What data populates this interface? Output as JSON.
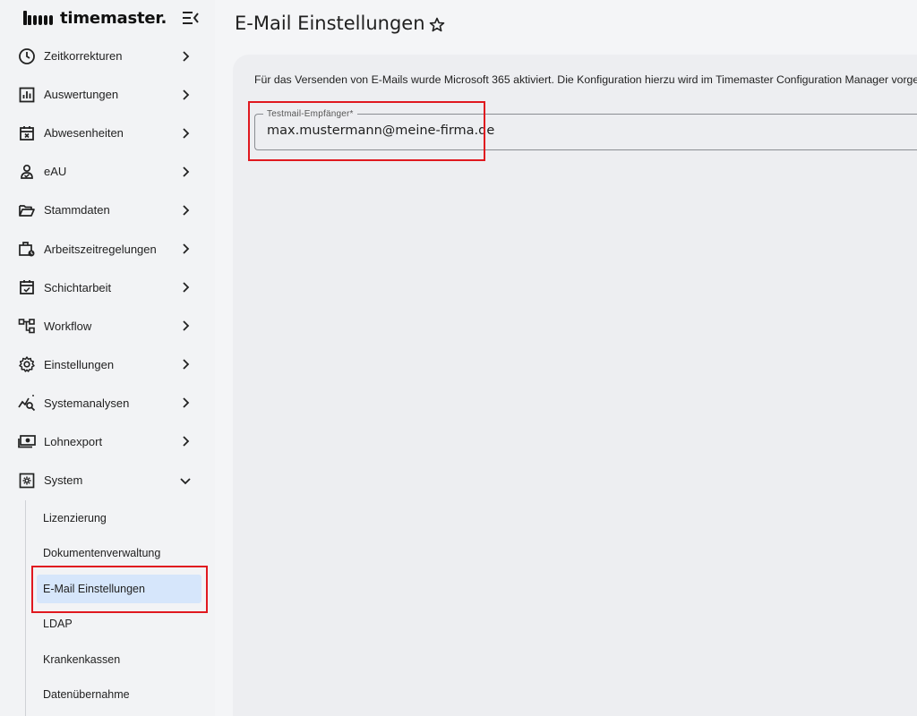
{
  "app": {
    "logo_text": "timemaster."
  },
  "sidebar": {
    "items": [
      {
        "label": "Zeitkorrekturen",
        "icon": "clock-icon"
      },
      {
        "label": "Auswertungen",
        "icon": "bar-chart-icon"
      },
      {
        "label": "Abwesenheiten",
        "icon": "calendar-x-icon"
      },
      {
        "label": "eAU",
        "icon": "person-check-icon"
      },
      {
        "label": "Stammdaten",
        "icon": "folder-open-icon"
      },
      {
        "label": "Arbeitszeitregelungen",
        "icon": "briefcase-clock-icon"
      },
      {
        "label": "Schichtarbeit",
        "icon": "calendar-check-icon"
      },
      {
        "label": "Workflow",
        "icon": "workflow-icon"
      },
      {
        "label": "Einstellungen",
        "icon": "gear-icon"
      },
      {
        "label": "Systemanalysen",
        "icon": "chart-search-icon"
      },
      {
        "label": "Lohnexport",
        "icon": "money-icon"
      },
      {
        "label": "System",
        "icon": "system-gear-icon"
      }
    ],
    "system_sub_items": [
      {
        "label": "Lizenzierung"
      },
      {
        "label": "Dokumentenverwaltung"
      },
      {
        "label": "E-Mail Einstellungen"
      },
      {
        "label": "LDAP"
      },
      {
        "label": "Krankenkassen"
      },
      {
        "label": "Datenübernahme"
      }
    ]
  },
  "main": {
    "title": "E-Mail Einstellungen",
    "info_text": "Für das Versenden von E-Mails wurde Microsoft 365 aktiviert. Die Konfiguration hierzu wird im Timemaster Configuration Manager vorgenommen.",
    "test_recipient": {
      "label": "Testmail-Empfänger*",
      "value": "max.mustermann@meine-firma.de"
    }
  },
  "colors": {
    "highlight": "#e0181f",
    "active_bg": "#d6e6fb",
    "sidebar_bg": "#f2f3f5",
    "card_bg": "#edeef1"
  }
}
